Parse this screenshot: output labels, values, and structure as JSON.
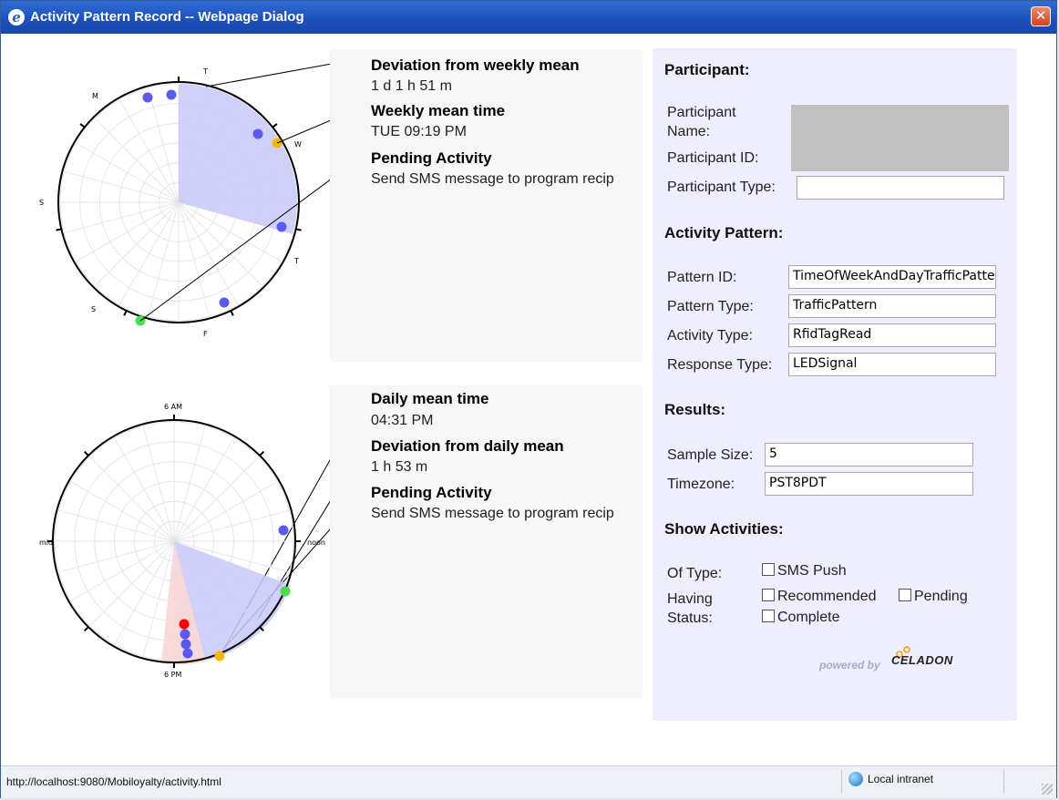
{
  "window": {
    "title": "Activity Pattern Record -- Webpage Dialog",
    "icon": "ie-icon",
    "close": "✕"
  },
  "weekly": {
    "labels": [
      "M",
      "T",
      "W",
      "T",
      "F",
      "S",
      "S"
    ],
    "info": [
      {
        "title": "Deviation from weekly mean",
        "value": "1 d 1 h 51 m"
      },
      {
        "title": "Weekly mean time",
        "value": "TUE 09:19 PM"
      },
      {
        "title": "Pending Activity",
        "value": "Send SMS message to program recip"
      }
    ]
  },
  "daily": {
    "labels": {
      "top": "6 AM",
      "right": "noon",
      "bottom": "6 PM",
      "left": "mid"
    },
    "info": [
      {
        "title": "Daily mean time",
        "value": "04:31 PM"
      },
      {
        "title": "Deviation from daily mean",
        "value": "1 h 53 m"
      },
      {
        "title": "Pending Activity",
        "value": "Send SMS message to program recip"
      }
    ]
  },
  "participant": {
    "section": "Participant:",
    "name_label": "Participant Name:",
    "id_label": "Participant ID:",
    "type_label": "Participant Type:",
    "type_value": ""
  },
  "pattern": {
    "section": "Activity Pattern:",
    "fields": [
      {
        "label": "Pattern ID:",
        "value": "TimeOfWeekAndDayTrafficPattern"
      },
      {
        "label": "Pattern Type:",
        "value": "TrafficPattern"
      },
      {
        "label": "Activity Type:",
        "value": "RfidTagRead"
      },
      {
        "label": "Response Type:",
        "value": "LEDSignal"
      }
    ]
  },
  "results": {
    "section": "Results:",
    "sample_label": "Sample Size:",
    "sample_value": "5",
    "tz_label": "Timezone:",
    "tz_value": "PST8PDT"
  },
  "show": {
    "section": "Show Activities:",
    "of_type_label": "Of Type:",
    "status_label_1": "Having",
    "status_label_2": "Status:",
    "opt_sms": "SMS Push",
    "opt_recommended": "Recommended",
    "opt_pending": "Pending",
    "opt_complete": "Complete"
  },
  "branding": {
    "powered": "powered by",
    "brand": "CELADON"
  },
  "status": {
    "url": "http://localhost:9080/Mobiloyalty/activity.html",
    "zone": "Local intranet"
  },
  "colors": {
    "wedge_blue": "#c8c8fa",
    "wedge_pink": "#f8d8d8",
    "dot_blue": "#5a5af0",
    "dot_orange": "#f5b800",
    "dot_green": "#4ddc4d",
    "dot_red": "#ff0000"
  }
}
